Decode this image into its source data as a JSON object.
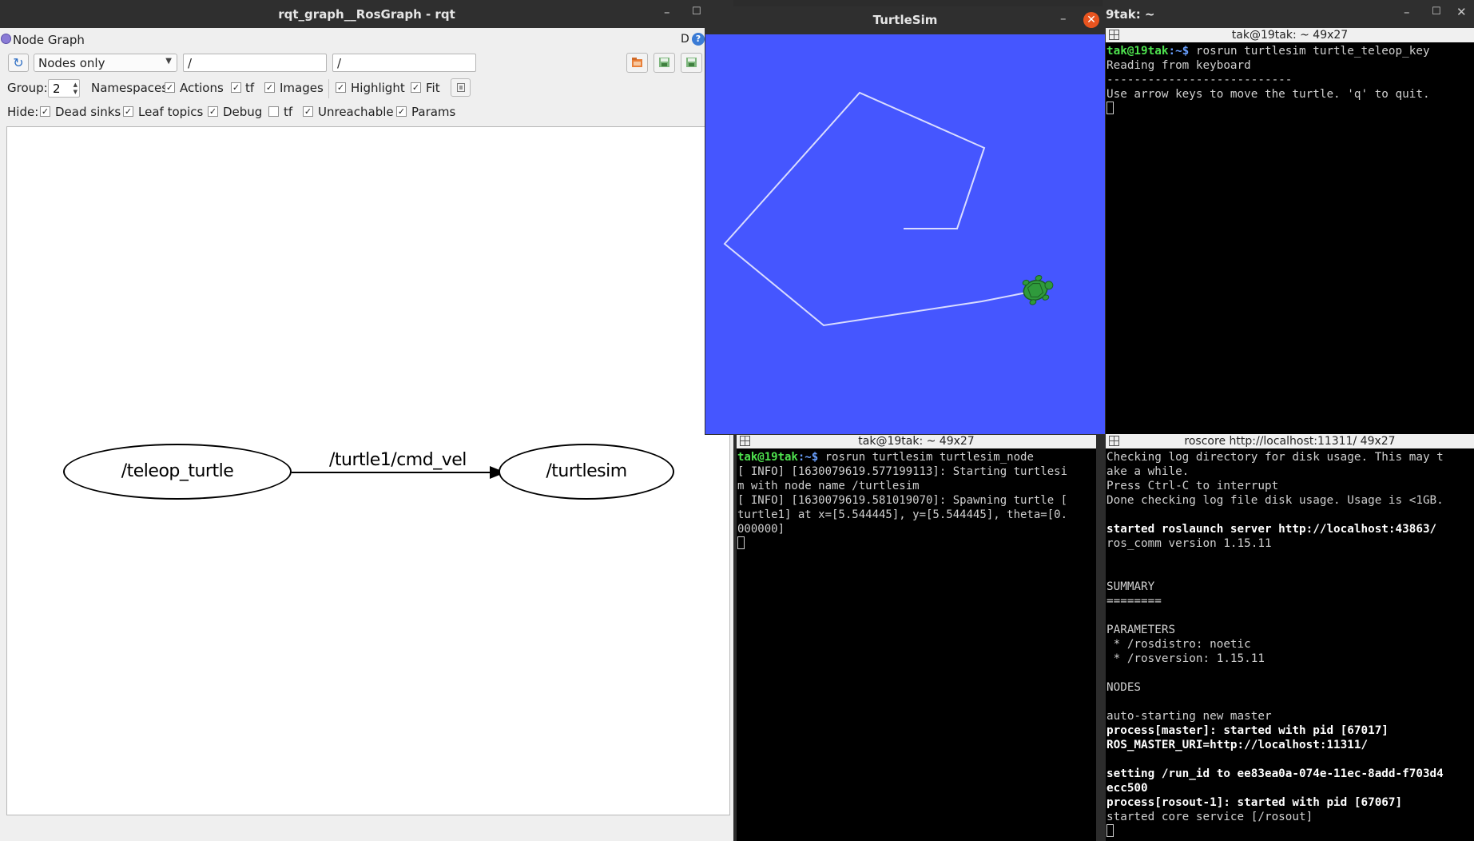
{
  "rqt": {
    "window_title": "rqt_graph__RosGraph - rqt",
    "plugin_title": "Node Graph",
    "d_label": "D",
    "help_label": "?",
    "refresh_glyph": "↻",
    "mode_select": "Nodes only",
    "node_filter": "/",
    "topic_filter": "/",
    "group_label": "Group:",
    "group_value": "2",
    "options": {
      "namespaces": "Namespaces",
      "actions": "Actions",
      "tf": "tf",
      "images": "Images",
      "highlight": "Highlight",
      "fit": "Fit"
    },
    "hide": {
      "label": "Hide:",
      "dead_sinks": "Dead sinks",
      "leaf_topics": "Leaf topics",
      "debug": "Debug",
      "tf": "tf",
      "unreachable": "Unreachable",
      "params": "Params"
    },
    "checks": {
      "namespaces": false,
      "actions": true,
      "tf": true,
      "images": true,
      "highlight": true,
      "fit": true,
      "dead_sinks": true,
      "leaf_topics": true,
      "debug": true,
      "tf_hide": false,
      "unreachable": true,
      "params": true
    },
    "graph": {
      "node_teleop": "/teleop_turtle",
      "edge_topic": "/turtle1/cmd_vel",
      "node_turtlesim": "/turtlesim"
    }
  },
  "turtlesim": {
    "title": "TurtleSim",
    "background": "#4556ff",
    "path_color": "#d9dcff",
    "turtle_color": "#2f9a3c"
  },
  "term_top_right": {
    "window_title": "9tak: ~",
    "tab_title": "tak@19tak: ~ 49x27",
    "prompt_user": "tak@19tak",
    "prompt_path": ":~$",
    "command": " rosrun turtlesim turtle_teleop_key",
    "lines": [
      "Reading from keyboard",
      "---------------------------",
      "Use arrow keys to move the turtle. 'q' to quit."
    ]
  },
  "term_bottom_middle": {
    "tab_title": "tak@19tak: ~ 49x27",
    "prompt_user": "tak@19tak",
    "prompt_path": ":~$",
    "command": " rosrun turtlesim turtlesim_node",
    "lines": [
      "[ INFO] [1630079619.577199113]: Starting turtlesi",
      "m with node name /turtlesim",
      "[ INFO] [1630079619.581019070]: Spawning turtle [",
      "turtle1] at x=[5.544445], y=[5.544445], theta=[0.",
      "000000]"
    ]
  },
  "term_bottom_right": {
    "tab_title": "roscore http://localhost:11311/ 49x27",
    "lines": [
      {
        "t": "Checking log directory for disk usage. This may t",
        "b": false
      },
      {
        "t": "ake a while.",
        "b": false
      },
      {
        "t": "Press Ctrl-C to interrupt",
        "b": false
      },
      {
        "t": "Done checking log file disk usage. Usage is <1GB.",
        "b": false
      },
      {
        "t": "",
        "b": false
      },
      {
        "t": "started roslaunch server http://localhost:43863/",
        "b": true
      },
      {
        "t": "ros_comm version 1.15.11",
        "b": false
      },
      {
        "t": "",
        "b": false
      },
      {
        "t": "",
        "b": false
      },
      {
        "t": "SUMMARY",
        "b": false
      },
      {
        "t": "========",
        "b": false
      },
      {
        "t": "",
        "b": false
      },
      {
        "t": "PARAMETERS",
        "b": false
      },
      {
        "t": " * /rosdistro: noetic",
        "b": false
      },
      {
        "t": " * /rosversion: 1.15.11",
        "b": false
      },
      {
        "t": "",
        "b": false
      },
      {
        "t": "NODES",
        "b": false
      },
      {
        "t": "",
        "b": false
      },
      {
        "t": "auto-starting new master",
        "b": false
      },
      {
        "t": "process[master]: started with pid [67017]",
        "b": true
      },
      {
        "t": "ROS_MASTER_URI=http://localhost:11311/",
        "b": true
      },
      {
        "t": "",
        "b": false
      },
      {
        "t": "setting /run_id to ee83ea0a-074e-11ec-8add-f703d4",
        "b": true
      },
      {
        "t": "ecc500",
        "b": true
      },
      {
        "t": "process[rosout-1]: started with pid [67067]",
        "b": true
      },
      {
        "t": "started core service [/rosout]",
        "b": false
      }
    ]
  }
}
